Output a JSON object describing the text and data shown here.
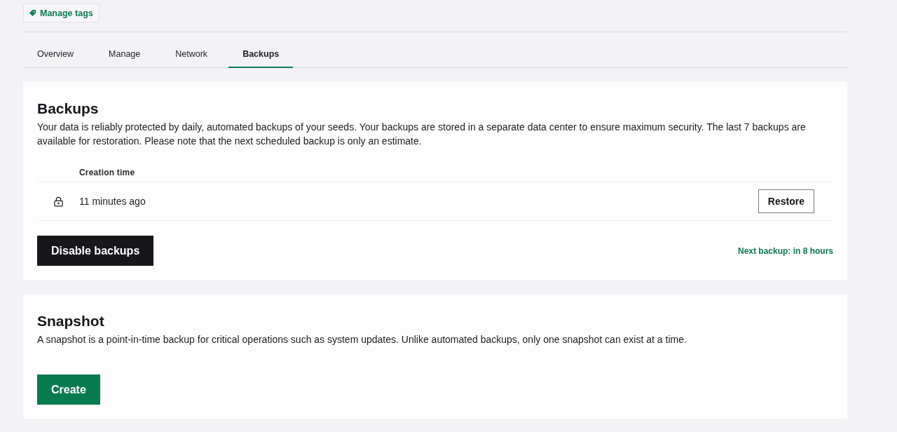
{
  "header": {
    "manage_tags_button": "Manage tags"
  },
  "tabs": [
    {
      "label": "Overview",
      "selected": false
    },
    {
      "label": "Manage",
      "selected": false
    },
    {
      "label": "Network",
      "selected": false
    },
    {
      "label": "Backups",
      "selected": true
    }
  ],
  "backups": {
    "title": "Backups",
    "description": "Your data is reliably protected by daily, automated backups of your seeds. Your backups are stored in a separate data center to ensure maximum security. The last 7 backups are available for restoration. Please note that the next scheduled backup is only an estimate.",
    "table": {
      "columns": [
        "Creation time"
      ],
      "rows": [
        {
          "creation_time": "11 minutes ago",
          "action": "Restore"
        }
      ]
    },
    "disable_button": "Disable backups",
    "next_backup": "Next backup: in 8 hours"
  },
  "snapshot": {
    "title": "Snapshot",
    "description": "A snapshot is a point-in-time backup for critical operations such as system updates. Unlike automated backups, only one snapshot can exist at a time.",
    "create_button": "Create"
  }
}
